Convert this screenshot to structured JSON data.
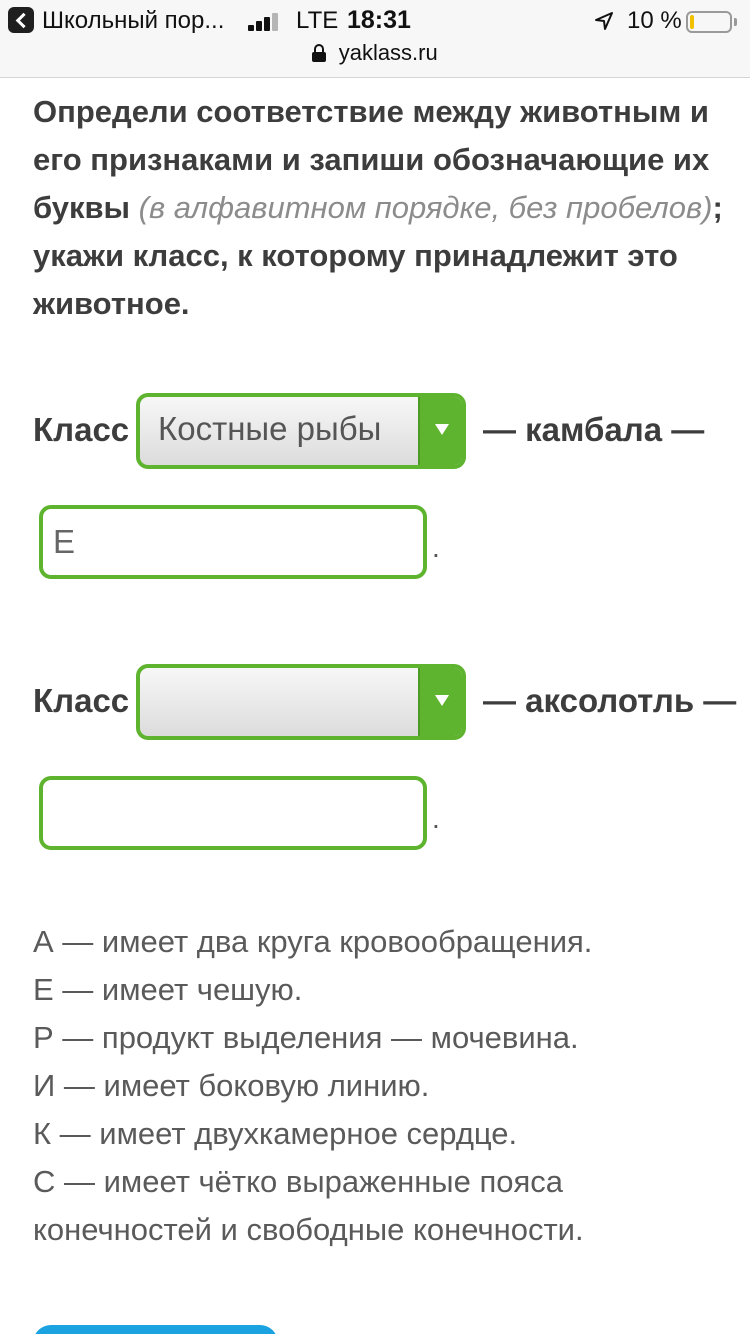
{
  "status_bar": {
    "back_app": "Школьный пор...",
    "carrier": "LTE",
    "time": "18:31",
    "battery_percent": "10 %",
    "battery_level": 0.1,
    "url": "yaklass.ru"
  },
  "question": {
    "part1": "Определи соответствие между животным и его признаками и запиши обозначающие их буквы ",
    "hint": "(в алфавитном порядке, без пробелов)",
    "part2": "; укажи класс, к которому принадлежит это животное."
  },
  "task1": {
    "label": "Класс",
    "selected": "Костные рыбы",
    "animal_text": "— камбала —",
    "answer": "Е",
    "period": "."
  },
  "task2": {
    "label": "Класс",
    "selected": "",
    "animal_text": "— аксолотль —",
    "answer": "",
    "period": "."
  },
  "options": [
    "А — имеет два круга кровообращения.",
    "Е — имеет чешую.",
    "Р — продукт выделения — мочевина.",
    "И — имеет боковую линию.",
    "К — имеет двухкамерное сердце.",
    "С — имеет чётко выраженные пояса конечностей и свободные конечности."
  ]
}
